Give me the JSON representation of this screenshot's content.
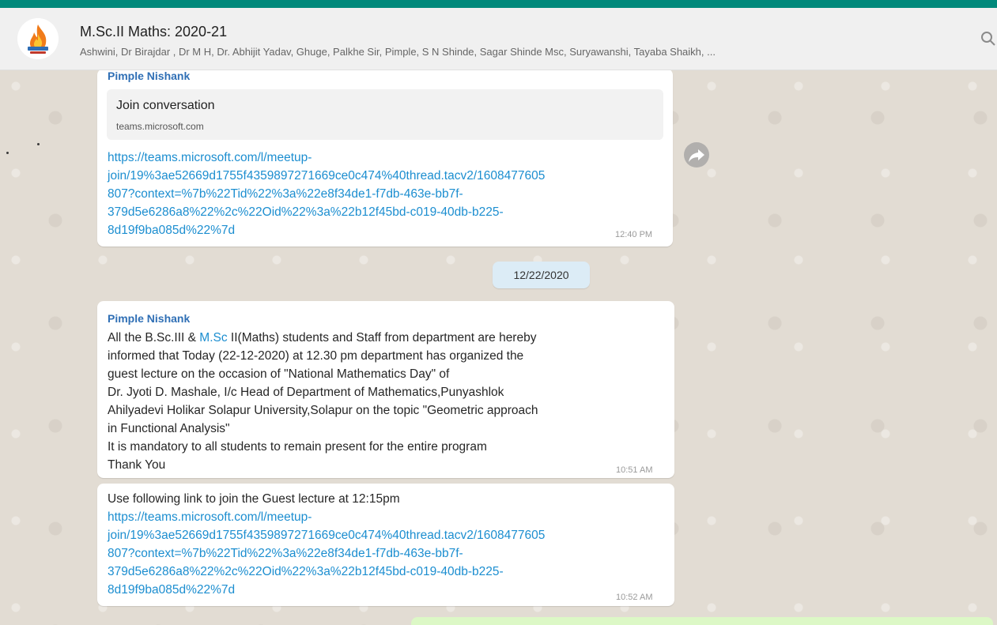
{
  "colors": {
    "accent": "#00897b",
    "header_bg": "#f0f0f0",
    "chat_bg": "#e2dcd3",
    "link": "#1c8ed0",
    "sender": "#2f6fb5",
    "date_chip": "#dcecf6",
    "outgoing_bubble": "#dcf8c6"
  },
  "chat": {
    "title": "M.Sc.II Maths: 2020-21",
    "members": "Ashwini, Dr Birajdar , Dr M H, Dr. Abhijit Yadav, Ghuge, Palkhe Sir, Pimple, S N Shinde, Sagar Shinde Msc, Suryawanshi, Tayaba Shaikh, ...",
    "avatar_icon": "fire-logo-icon",
    "search_icon": "search-icon"
  },
  "messages": {
    "m1": {
      "sender": "Pimple Nishank",
      "preview_title": "Join conversation",
      "preview_domain": "teams.microsoft.com",
      "link_lines": [
        "https://teams.microsoft.com/l/meetup-",
        "join/19%3ae52669d1755f4359897271669ce0c474%40thread.tacv2/1608477605",
        "807?context=%7b%22Tid%22%3a%22e8f34de1-f7db-463e-bb7f-",
        "379d5e6286a8%22%2c%22Oid%22%3a%22b12f45bd-c019-40db-b225-",
        "8d19f9ba085d%22%7d"
      ],
      "time": "12:40 PM"
    },
    "date_divider": "12/22/2020",
    "m2": {
      "sender": "Pimple Nishank",
      "line1_prefix": "All the B.Sc.III & ",
      "line1_link": "M.Sc",
      "line1_suffix": " II(Maths) students and Staff from department are hereby",
      "lines": [
        "informed that Today (22-12-2020) at 12.30 pm department has organized the",
        "guest lecture on the occasion of \"National Mathematics Day\" of",
        "Dr. Jyoti D. Mashale, I/c Head of Department of Mathematics,Punyashlok",
        "Ahilyadevi Holikar Solapur University,Solapur on the topic \"Geometric approach",
        "in Functional Analysis\"",
        "It is mandatory to all students to  remain present for the entire  program",
        "Thank You"
      ],
      "time": "10:51 AM"
    },
    "m3": {
      "text": "Use following link to join the Guest lecture at 12:15pm",
      "link_lines": [
        "https://teams.microsoft.com/l/meetup-",
        "join/19%3ae52669d1755f4359897271669ce0c474%40thread.tacv2/1608477605",
        "807?context=%7b%22Tid%22%3a%22e8f34de1-f7db-463e-bb7f-",
        "379d5e6286a8%22%2c%22Oid%22%3a%22b12f45bd-c019-40db-b225-",
        "8d19f9ba085d%22%7d"
      ],
      "time": "10:52 AM"
    }
  },
  "forward_icon": "forward-arrow-icon"
}
